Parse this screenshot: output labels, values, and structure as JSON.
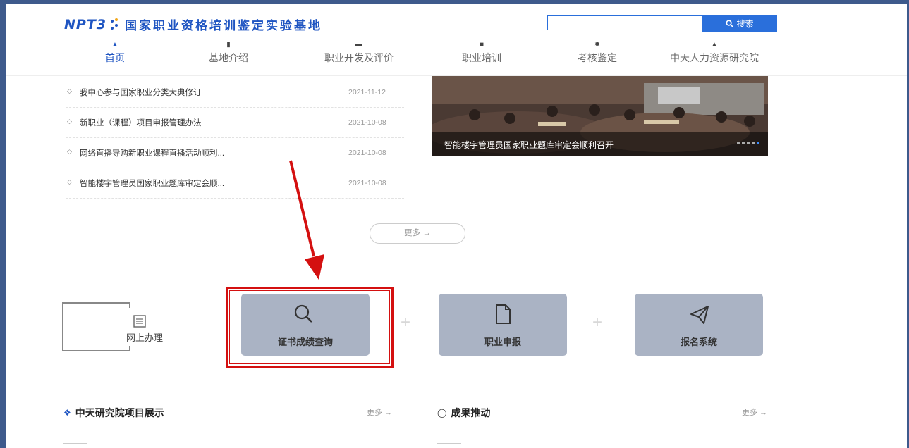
{
  "header": {
    "logo_text": "NPT3",
    "site_title": "国家职业资格培训鉴定实验基地",
    "search_placeholder": "",
    "search_button": "搜索"
  },
  "nav": [
    {
      "label": "首页",
      "icon": "home-icon",
      "active": true
    },
    {
      "label": "基地介绍",
      "icon": "book-icon",
      "active": false
    },
    {
      "label": "职业开发及评价",
      "icon": "briefcase-icon",
      "active": false
    },
    {
      "label": "职业培训",
      "icon": "open-book-icon",
      "active": false
    },
    {
      "label": "考核鉴定",
      "icon": "gear-icon",
      "active": false
    },
    {
      "label": "中天人力资源研究院",
      "icon": "institute-icon",
      "active": false
    }
  ],
  "news": [
    {
      "title": "我中心参与国家职业分类大典修订",
      "date": "2021-11-12"
    },
    {
      "title": "新职业（课程）项目申报管理办法",
      "date": "2021-10-08"
    },
    {
      "title": "网络直播导购新职业课程直播活动顺利...",
      "date": "2021-10-08"
    },
    {
      "title": "智能楼宇管理员国家职业题库审定会顺...",
      "date": "2021-10-08"
    }
  ],
  "banner": {
    "caption": "智能楼宇管理员国家职业题库审定会顺利召开"
  },
  "more_button": "更多 →",
  "services": {
    "online_label": "网上办理",
    "items": [
      {
        "label": "证书成绩查询",
        "icon": "search-icon"
      },
      {
        "label": "职业申报",
        "icon": "document-icon"
      },
      {
        "label": "报名系统",
        "icon": "paper-plane-icon"
      }
    ]
  },
  "sections": [
    {
      "title": "中天研究院项目展示",
      "more": "更多 →"
    },
    {
      "title": "成果推动",
      "more": "更多 →"
    }
  ]
}
